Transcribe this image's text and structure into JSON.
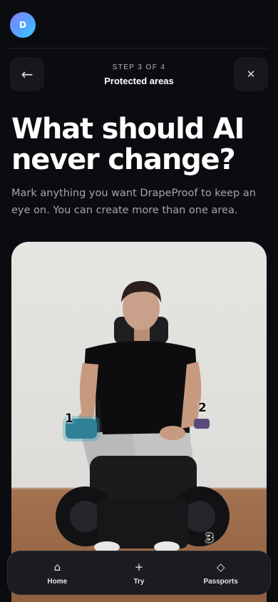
{
  "header": {
    "avatar_initial": "D"
  },
  "nav": {
    "back_icon": "←",
    "close_icon": "✕"
  },
  "step": {
    "indicator": "STEP 3 OF 4",
    "title": "Protected areas"
  },
  "main": {
    "headline": "What should AI never change?",
    "subtext": "Mark anything you want DrapeProof to keep an eye on. You can create more than one area."
  },
  "photo": {
    "markers": [
      "1",
      "2",
      "3"
    ]
  },
  "tabbar": {
    "items": [
      {
        "label": "Home",
        "icon": "⌂"
      },
      {
        "label": "Try",
        "icon": "+"
      },
      {
        "label": "Passports",
        "icon": "◇"
      }
    ]
  }
}
